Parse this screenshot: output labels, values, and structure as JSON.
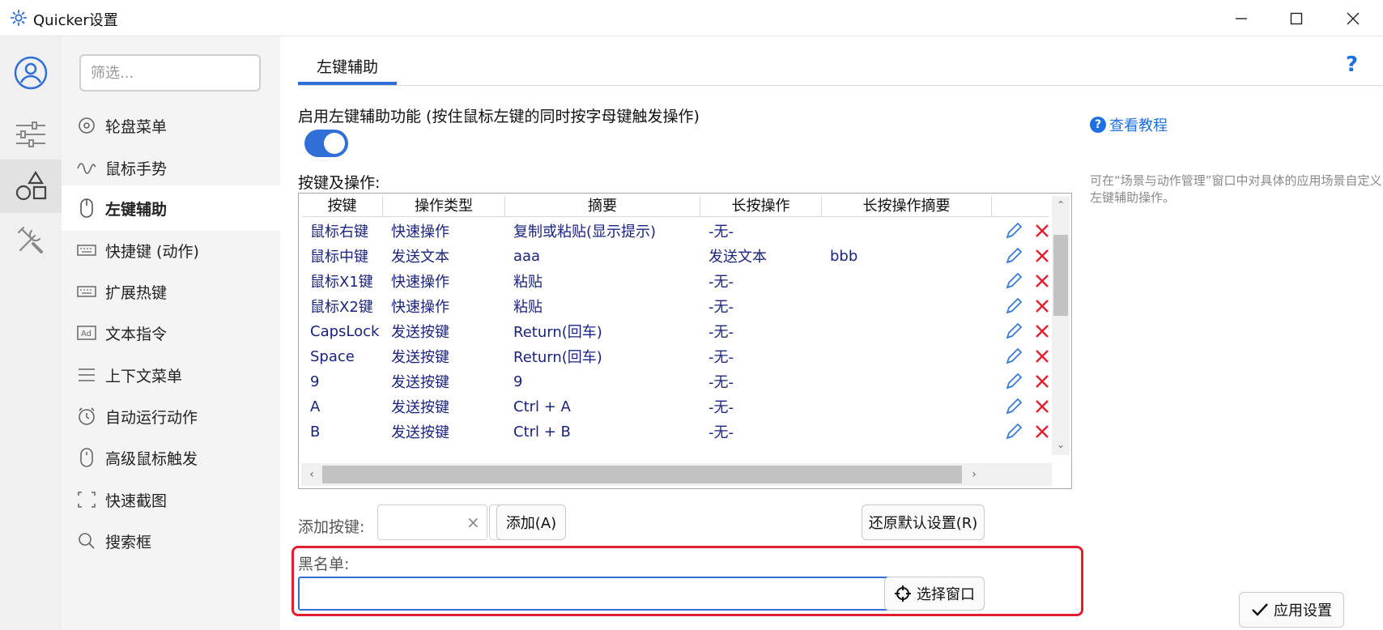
{
  "window": {
    "title": "Quicker设置"
  },
  "filter": {
    "placeholder": "筛选..."
  },
  "nav": {
    "items": [
      {
        "label": "轮盘菜单"
      },
      {
        "label": "鼠标手势"
      },
      {
        "label": "左键辅助"
      },
      {
        "label": "快捷键 (动作)"
      },
      {
        "label": "扩展热键"
      },
      {
        "label": "文本指令"
      },
      {
        "label": "上下文菜单"
      },
      {
        "label": "自动运行动作"
      },
      {
        "label": "高级鼠标触发"
      },
      {
        "label": "快速截图"
      },
      {
        "label": "搜索框"
      }
    ]
  },
  "main": {
    "tab": "左键辅助",
    "help": "?",
    "enable_label": "启用左键辅助功能 (按住鼠标左键的同时按字母键触发操作)",
    "toggle_on": true,
    "tutorial": "查看教程",
    "side_note": "可在“场景与动作管理”窗口中对具体的应用场景自定义左键辅助操作。",
    "keys_label": "按键及操作:",
    "table": {
      "headers": [
        "按键",
        "操作类型",
        "摘要",
        "长按操作",
        "长按操作摘要"
      ],
      "rows": [
        [
          "鼠标右键",
          "快速操作",
          "复制或粘贴(显示提示)",
          "-无-",
          ""
        ],
        [
          "鼠标中键",
          "发送文本",
          "aaa",
          "发送文本",
          "bbb"
        ],
        [
          "鼠标X1键",
          "快速操作",
          "粘贴",
          "-无-",
          ""
        ],
        [
          "鼠标X2键",
          "快速操作",
          "粘贴",
          "-无-",
          ""
        ],
        [
          "CapsLock",
          "发送按键",
          "Return(回车)",
          "-无-",
          ""
        ],
        [
          "Space",
          "发送按键",
          "Return(回车)",
          "-无-",
          ""
        ],
        [
          "9",
          "发送按键",
          "9",
          "-无-",
          ""
        ],
        [
          "A",
          "发送按键",
          "Ctrl + A",
          "-无-",
          ""
        ],
        [
          "B",
          "发送按键",
          "Ctrl + B",
          "-无-",
          ""
        ]
      ]
    },
    "add_label": "添加按键:",
    "add_button": "添加(A)",
    "restore_button": "还原默认设置(R)",
    "blacklist_label": "黑名单:",
    "blacklist_value": "",
    "select_window_button": "选择窗口",
    "apply_button": "应用设置"
  },
  "colors": {
    "accent": "#2f6fd6",
    "danger": "#e02030",
    "link": "#1e6fe0",
    "cell_text": "#1a237e"
  }
}
